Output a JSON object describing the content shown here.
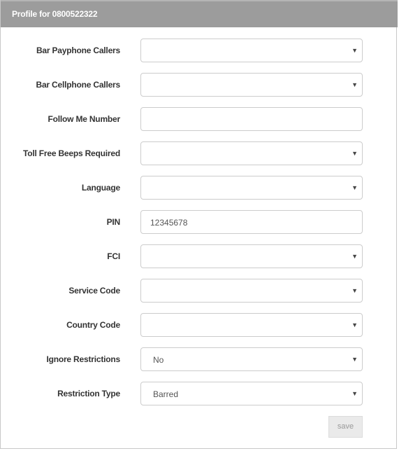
{
  "header": {
    "title": "Profile for 0800522322"
  },
  "form": {
    "fields": [
      {
        "label": "Bar Payphone Callers",
        "type": "select",
        "value": ""
      },
      {
        "label": "Bar Cellphone Callers",
        "type": "select",
        "value": ""
      },
      {
        "label": "Follow Me Number",
        "type": "text",
        "value": ""
      },
      {
        "label": "Toll Free Beeps Required",
        "type": "select",
        "value": ""
      },
      {
        "label": "Language",
        "type": "select",
        "value": ""
      },
      {
        "label": "PIN",
        "type": "text",
        "value": "12345678"
      },
      {
        "label": "FCI",
        "type": "select",
        "value": ""
      },
      {
        "label": "Service Code",
        "type": "select",
        "value": ""
      },
      {
        "label": "Country Code",
        "type": "select",
        "value": ""
      },
      {
        "label": "Ignore Restrictions",
        "type": "select",
        "value": "No"
      },
      {
        "label": "Restriction Type",
        "type": "select",
        "value": "Barred"
      }
    ],
    "caret_glyph": "▼",
    "save_label": "save"
  }
}
